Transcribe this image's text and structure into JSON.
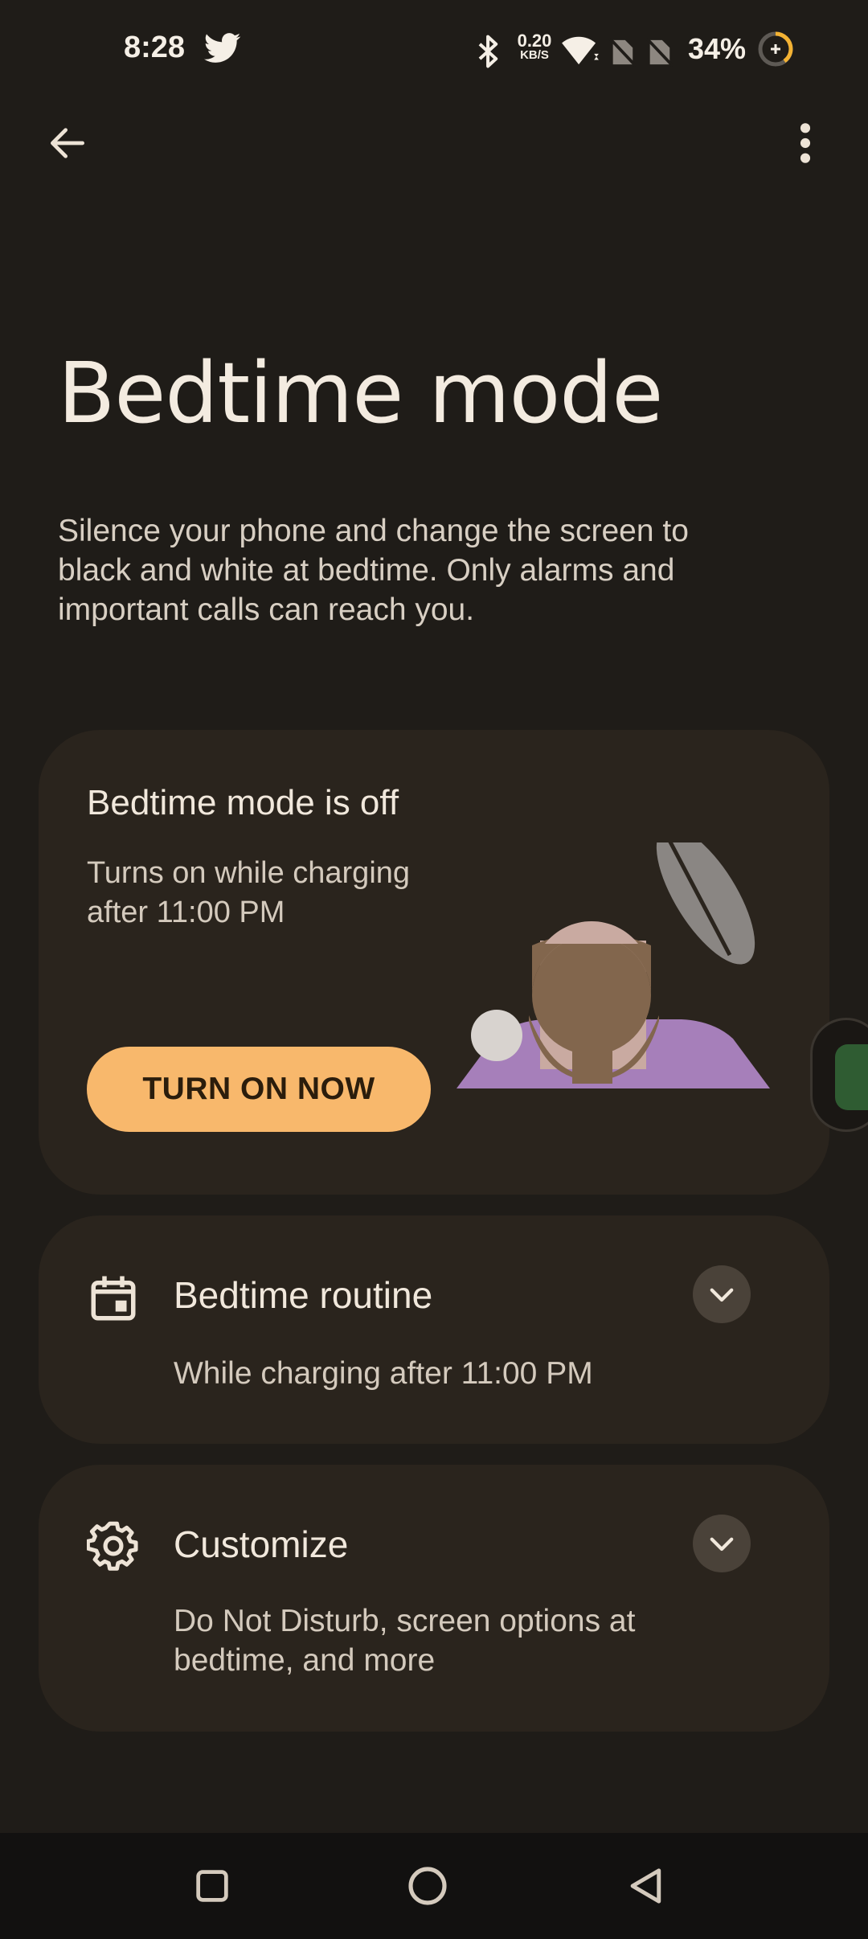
{
  "status_bar": {
    "time": "8:28",
    "net_speed_value": "0.20",
    "net_speed_unit": "KB/S",
    "battery": "34%",
    "icons": [
      "twitter-icon",
      "bluetooth-icon",
      "wifi-icon",
      "no-sim-icon",
      "no-sim-icon",
      "battery-charging-icon"
    ]
  },
  "app_bar": {
    "back_icon": "arrow-back-icon",
    "menu_icon": "more-vert-icon"
  },
  "page": {
    "title": "Bedtime mode",
    "description": "Silence your phone and change the screen to black and white at bedtime. Only alarms and important calls can reach you."
  },
  "status_card": {
    "title": "Bedtime mode is off",
    "subtitle": "Turns on while charging after 11:00 PM",
    "button_label": "TURN ON NOW"
  },
  "routine_card": {
    "title": "Bedtime routine",
    "subtitle": "While charging after 11:00 PM",
    "icon": "calendar-icon"
  },
  "customize_card": {
    "title": "Customize",
    "subtitle": "Do Not Disturb, screen options at bedtime, and more",
    "icon": "gear-icon"
  },
  "colors": {
    "background": "#1f1c18",
    "card": "#2a241d",
    "accent_button": "#f8b86c",
    "expand_button": "#4a4239"
  }
}
